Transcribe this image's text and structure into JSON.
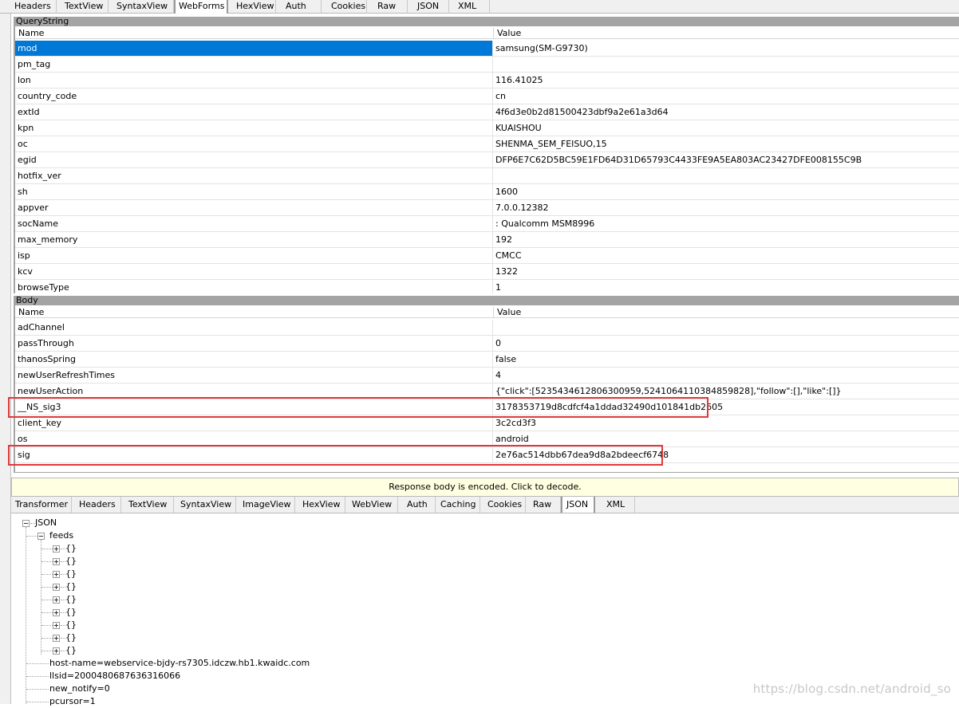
{
  "request_tabs": [
    "Headers",
    "TextView",
    "SyntaxView",
    "WebForms",
    "HexView",
    "Auth",
    "Cookies",
    "Raw",
    "JSON",
    "XML"
  ],
  "selected_request_tab": "WebForms",
  "querystring": {
    "title": "QueryString",
    "col_name": "Name",
    "col_value": "Value",
    "rows": [
      {
        "name": "mod",
        "value": "samsung(SM-G9730)"
      },
      {
        "name": "pm_tag",
        "value": ""
      },
      {
        "name": "lon",
        "value": "116.41025"
      },
      {
        "name": "country_code",
        "value": "cn"
      },
      {
        "name": "extId",
        "value": "4f6d3e0b2d81500423dbf9a2e61a3d64"
      },
      {
        "name": "kpn",
        "value": "KUAISHOU"
      },
      {
        "name": "oc",
        "value": "SHENMA_SEM_FEISUO,15"
      },
      {
        "name": "egid",
        "value": "DFP6E7C62D5BC59E1FD64D31D65793C4433FE9A5EA803AC23427DFE008155C9B"
      },
      {
        "name": "hotfix_ver",
        "value": ""
      },
      {
        "name": "sh",
        "value": "1600"
      },
      {
        "name": "appver",
        "value": "7.0.0.12382"
      },
      {
        "name": "socName",
        "value": ": Qualcomm MSM8996"
      },
      {
        "name": "max_memory",
        "value": "192"
      },
      {
        "name": "isp",
        "value": "CMCC"
      },
      {
        "name": "kcv",
        "value": "1322"
      },
      {
        "name": "browseType",
        "value": "1"
      }
    ]
  },
  "body": {
    "title": "Body",
    "col_name": "Name",
    "col_value": "Value",
    "rows": [
      {
        "name": "adChannel",
        "value": ""
      },
      {
        "name": "passThrough",
        "value": "0"
      },
      {
        "name": "thanosSpring",
        "value": "false"
      },
      {
        "name": "newUserRefreshTimes",
        "value": "4"
      },
      {
        "name": "newUserAction",
        "value": "{\"click\":[5235434612806300959,5241064110384859828],\"follow\":[],\"like\":[]}"
      },
      {
        "name": "__NS_sig3",
        "value": "3178353719d8cdfcf4a1ddad32490d101841db2605"
      },
      {
        "name": "client_key",
        "value": "3c2cd3f3"
      },
      {
        "name": "os",
        "value": "android"
      },
      {
        "name": "sig",
        "value": "2e76ac514dbb67dea9d8a2bdeecf6748"
      }
    ]
  },
  "notice": "Response body is encoded. Click to decode.",
  "response_tabs": [
    "Transformer",
    "Headers",
    "TextView",
    "SyntaxView",
    "ImageView",
    "HexView",
    "WebView",
    "Auth",
    "Caching",
    "Cookies",
    "Raw",
    "JSON",
    "XML"
  ],
  "selected_response_tab": "JSON",
  "tree": {
    "root": "JSON",
    "feeds_label": "feeds",
    "feed_items": [
      "{}",
      "{}",
      "{}",
      "{}",
      "{}",
      "{}",
      "{}",
      "{}",
      "{}"
    ],
    "leaves": [
      "host-name=webservice-bjdy-rs7305.idczw.hb1.kwaidc.com",
      "llsid=2000480687636316066",
      "new_notify=0",
      "pcursor=1"
    ]
  },
  "watermark": "https://blog.csdn.net/android_so",
  "colors": {
    "selection": "#0078d7",
    "highlight": "#e0393b",
    "notice_bg": "#ffffe1",
    "section_bg": "#a4a4a4"
  }
}
